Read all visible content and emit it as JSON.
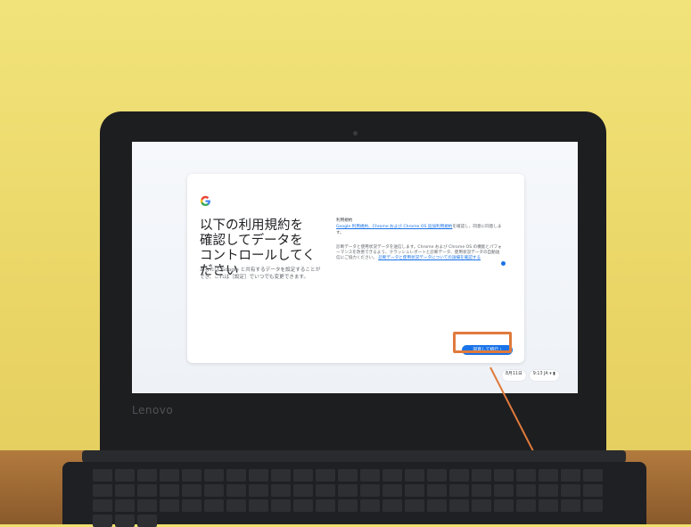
{
  "brand": "Lenovo",
  "setup_card": {
    "heading": "以下の利用規約を確認してデータをコントロールしてください",
    "subtext": "あなたは Google と共有するデータを設定することができ、これは［設定］でいつでも変更できます。",
    "right": {
      "section_title": "利用規約",
      "terms_line_pre": "",
      "terms_link": "Google 利用規約、Chrome および Chrome OS 追加利用規約",
      "terms_line_post": "を確認し、同意に同意します。",
      "diagnostics_text": "診断データと使用状況データを送信します。Chrome および Chrome OS の機能とパフォーマンスを改善できるよう、クラッシュレポートと診断データ、使用状況データの自動送信にご協力ください。",
      "diagnostics_link": "診断データと使用状況データについての詳細を確認する"
    },
    "accept_button": "同意して続行"
  },
  "shelf": {
    "date": "8月11日",
    "time": "9:13 JA"
  },
  "colors": {
    "accent": "#1a73e8",
    "highlight": "#e07a3c"
  },
  "icons": {
    "google_logo": "google-g-icon",
    "wifi": "wifi-icon",
    "battery": "battery-icon"
  }
}
